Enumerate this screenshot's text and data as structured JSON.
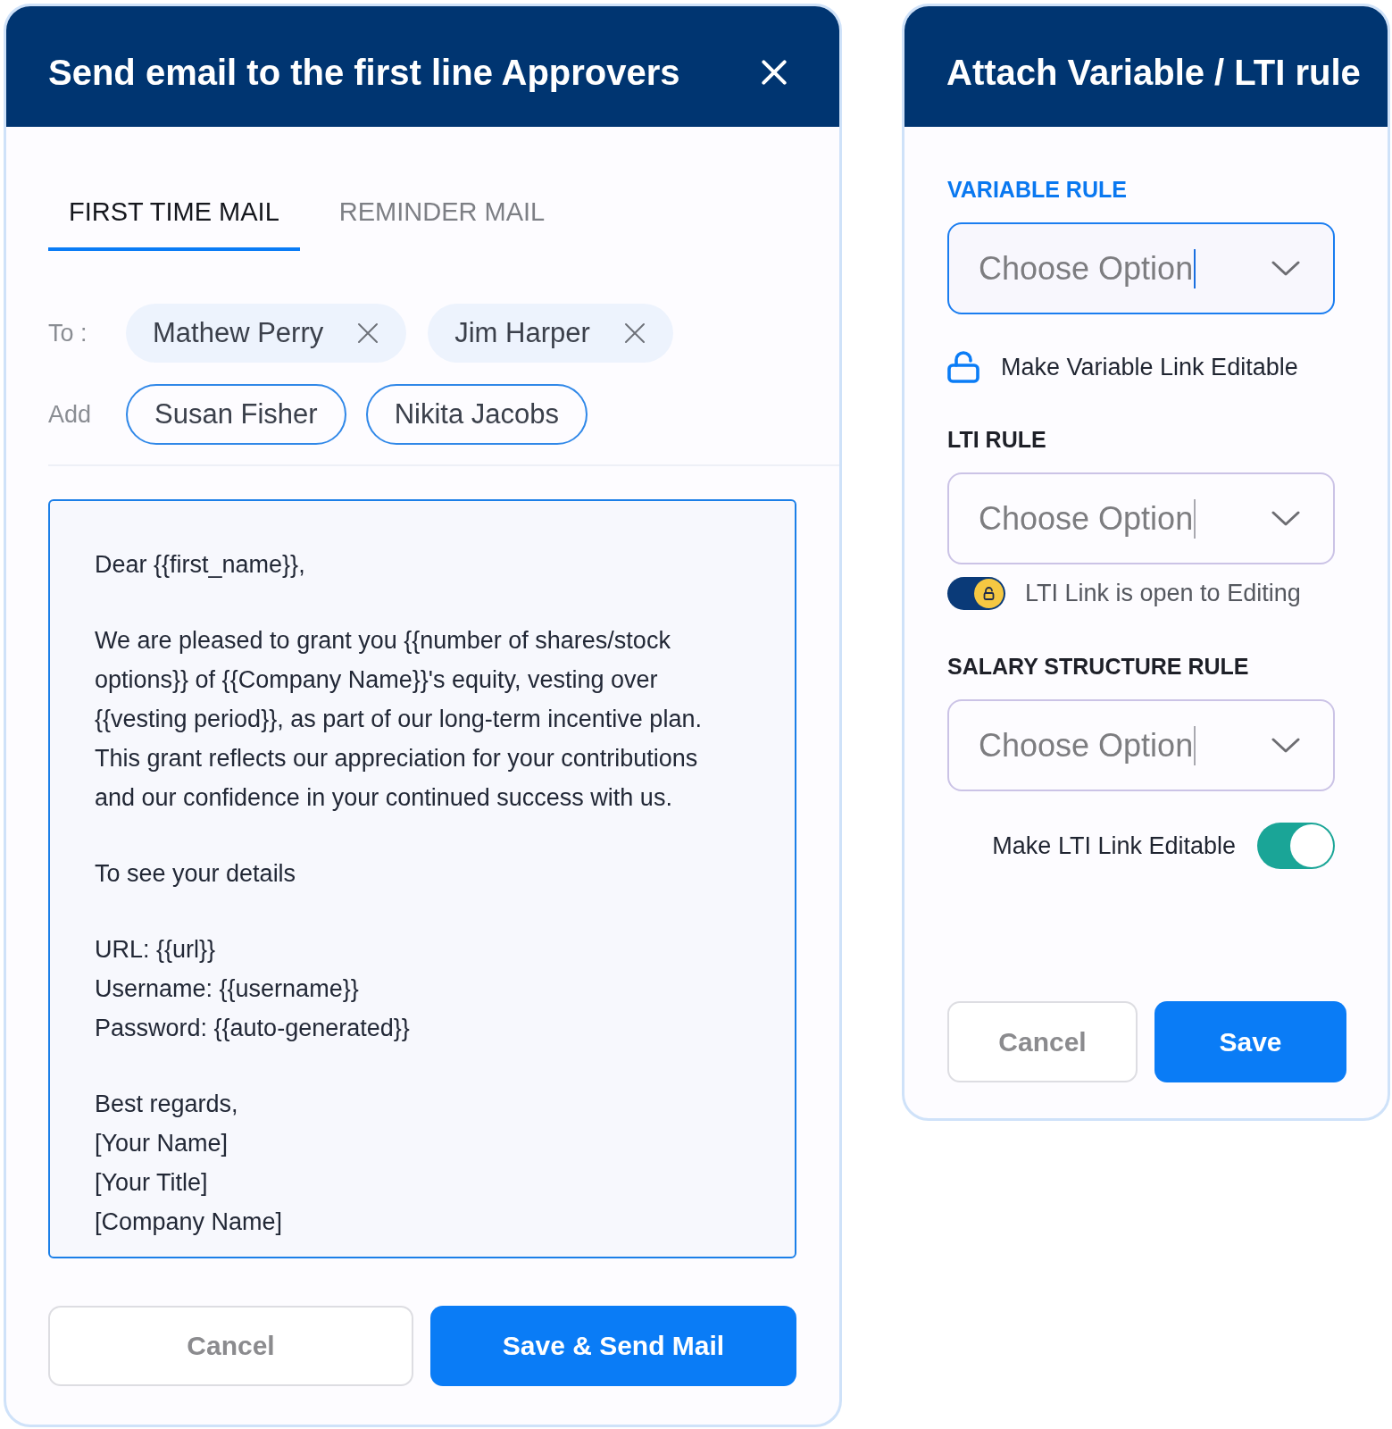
{
  "email_dialog": {
    "title": "Send email to the first line Approvers",
    "tabs": [
      {
        "label": "FIRST TIME MAIL",
        "selected": true
      },
      {
        "label": "REMINDER MAIL",
        "selected": false
      }
    ],
    "to": {
      "label": "To :",
      "recipients": [
        {
          "name": "Mathew Perry"
        },
        {
          "name": "Jim Harper"
        }
      ]
    },
    "add": {
      "label": "Add",
      "suggestions": [
        {
          "name": "Susan Fisher"
        },
        {
          "name": "Nikita Jacobs"
        }
      ]
    },
    "body": {
      "paragraphs": [
        {
          "lines": [
            "Dear {{first_name}},"
          ]
        },
        {
          "lines": [
            "We are pleased to grant you {{number of shares/stock",
            "options}} of {{Company Name}}'s equity, vesting over",
            "{{vesting period}}, as part of our long-term incentive plan.",
            "This grant reflects our appreciation for your contributions",
            "and our confidence in your continued success with us."
          ]
        },
        {
          "lines": [
            "To see your details"
          ]
        },
        {
          "lines": [
            "URL: {{url}}",
            "Username: {{username}}",
            "Password: {{auto-generated}}"
          ]
        },
        {
          "lines": [
            "Best regards,",
            "[Your Name]",
            "[Your Title]",
            "[Company Name]"
          ]
        }
      ]
    },
    "buttons": [
      {
        "label": "Cancel",
        "kind": "secondary"
      },
      {
        "label": "Save & Send Mail",
        "kind": "primary"
      }
    ]
  },
  "rule_dialog": {
    "title": "Attach Variable / LTI rule",
    "sections": [
      {
        "label": "VARIABLE RULE",
        "focused": true,
        "select": {
          "placeholder": "Choose Option"
        },
        "option": {
          "kind": "lock",
          "label": "Make Variable Link Editable",
          "locked": false
        }
      },
      {
        "label": "LTI RULE",
        "focused": false,
        "select": {
          "placeholder": "Choose Option"
        },
        "option": {
          "kind": "lock-toggle",
          "label": "LTI Link is open to Editing",
          "on": true
        }
      },
      {
        "label": "SALARY STRUCTURE RULE",
        "focused": false,
        "select": {
          "placeholder": "Choose Option"
        },
        "option": {
          "kind": "switch",
          "label": "Make LTI Link Editable",
          "on": true
        }
      }
    ],
    "buttons": [
      {
        "label": "Cancel",
        "kind": "secondary"
      },
      {
        "label": "Save",
        "kind": "primary"
      }
    ]
  }
}
